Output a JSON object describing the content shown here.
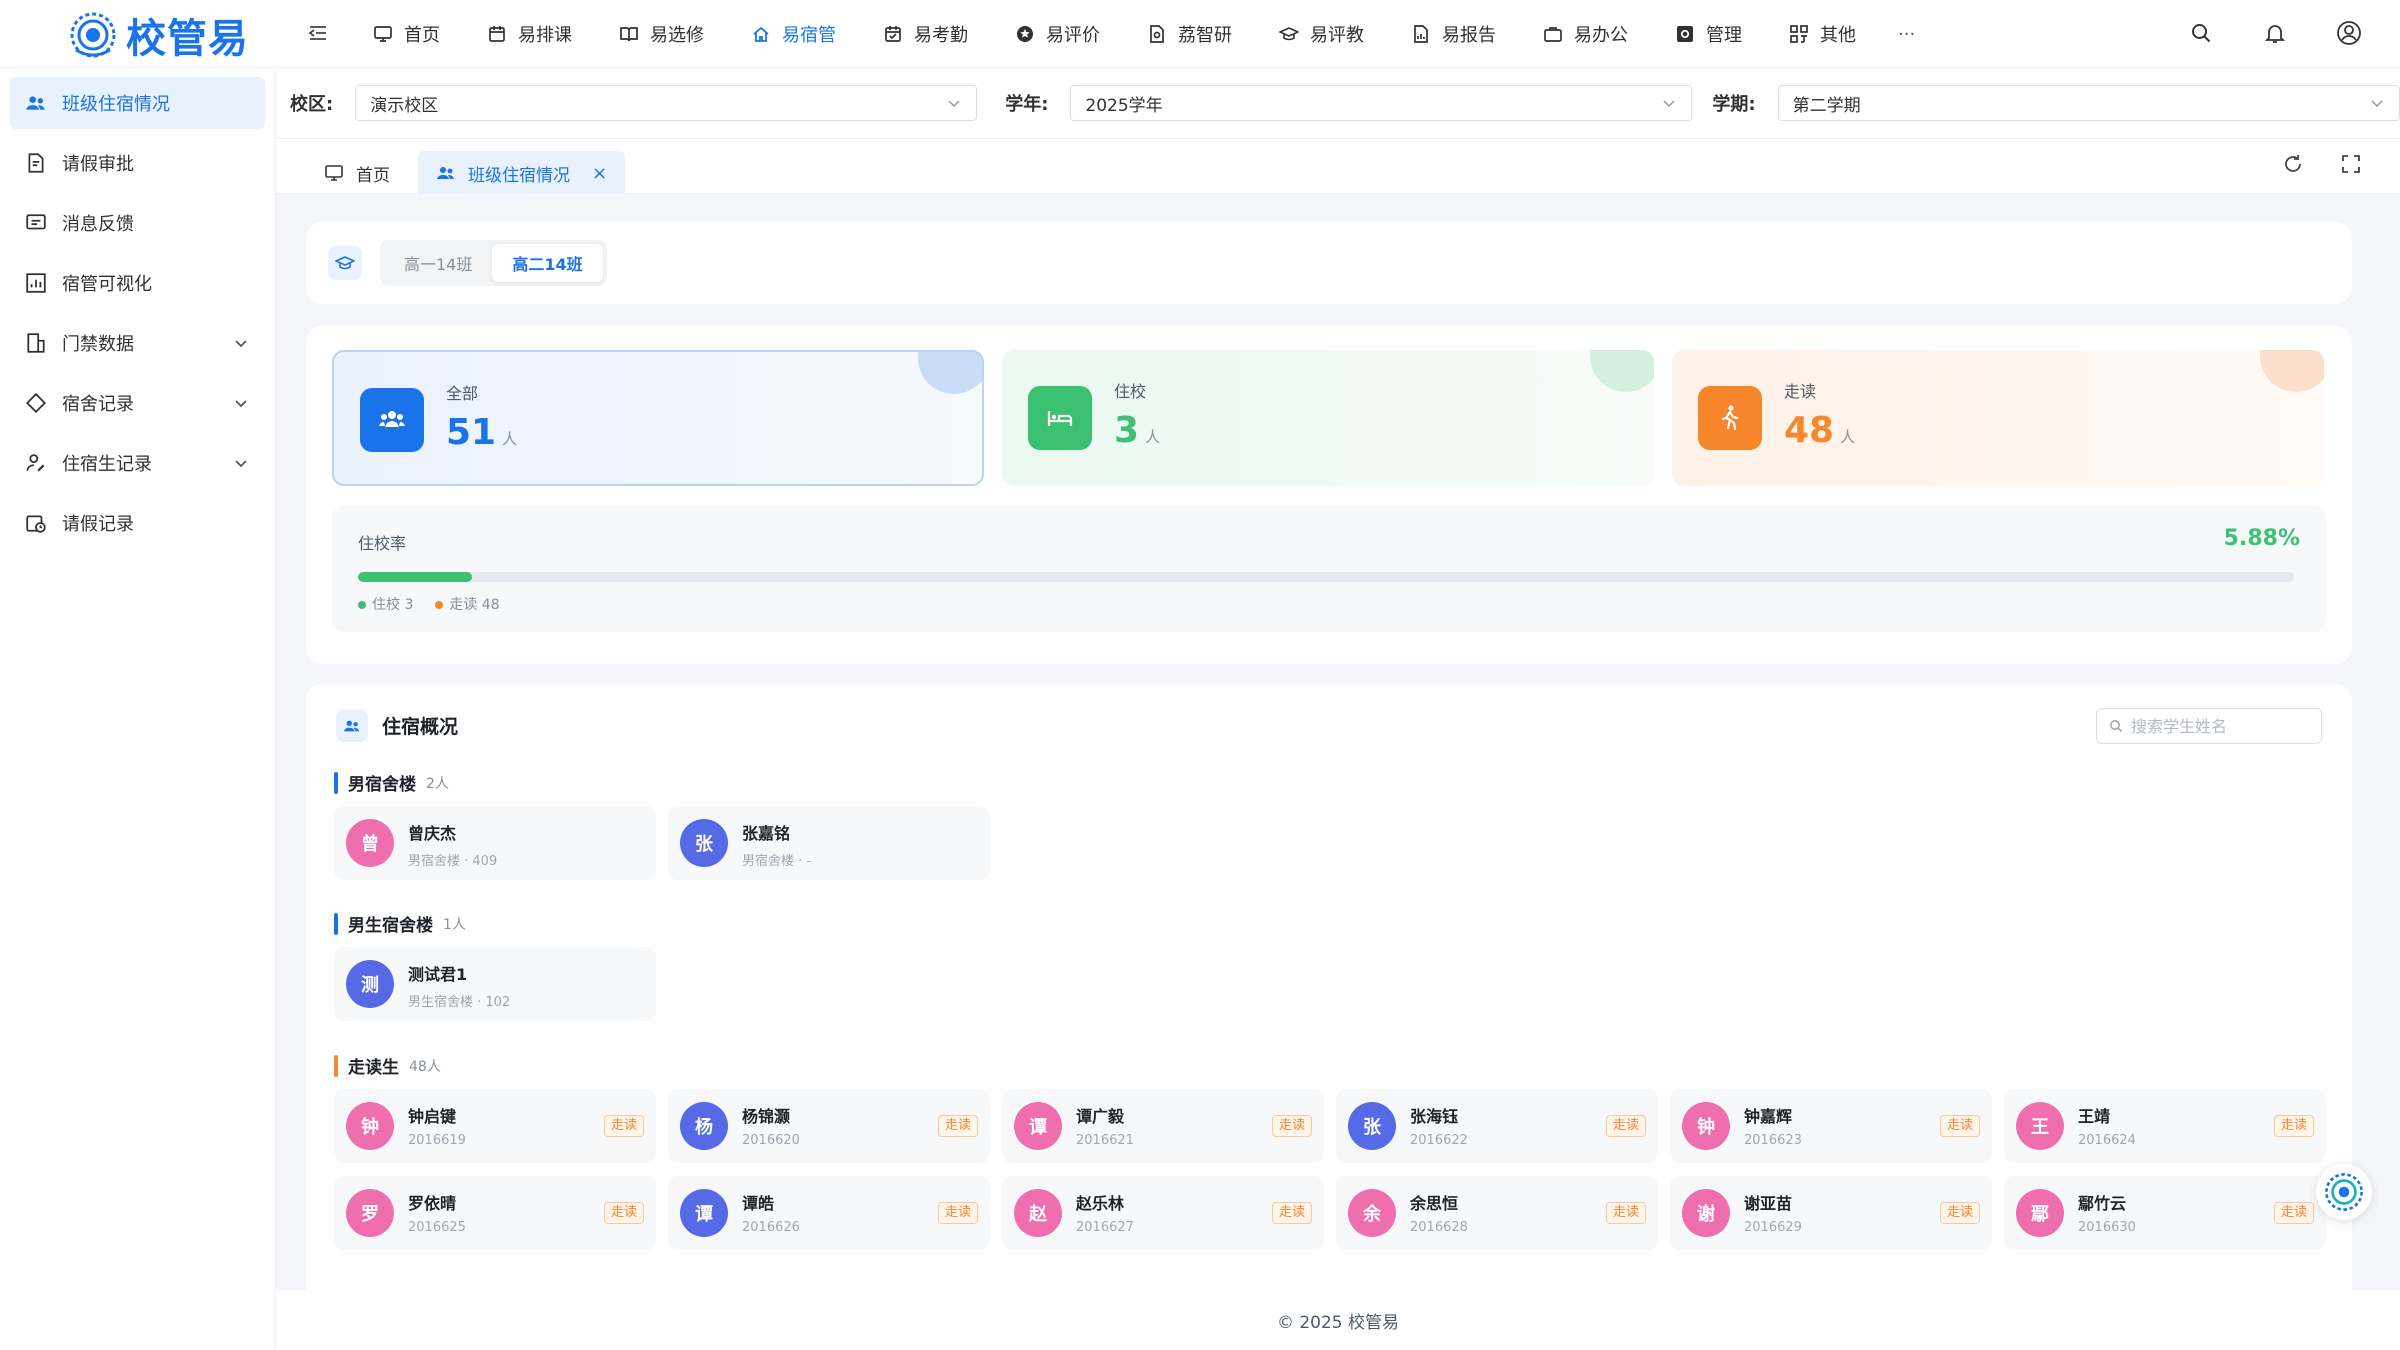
{
  "app": {
    "logo_text": "校管易"
  },
  "nav": [
    {
      "label": "首页",
      "icon": "monitor-icon"
    },
    {
      "label": "易排课",
      "icon": "calendar-icon"
    },
    {
      "label": "易选修",
      "icon": "book-icon"
    },
    {
      "label": "易宿管",
      "icon": "house-icon",
      "active": true
    },
    {
      "label": "易考勤",
      "icon": "calendar-check-icon"
    },
    {
      "label": "易评价",
      "icon": "star-icon"
    },
    {
      "label": "荔智研",
      "icon": "research-icon"
    },
    {
      "label": "易评教",
      "icon": "graduation-icon"
    },
    {
      "label": "易报告",
      "icon": "report-icon"
    },
    {
      "label": "易办公",
      "icon": "briefcase-icon"
    },
    {
      "label": "管理",
      "icon": "gear-icon"
    },
    {
      "label": "其他",
      "icon": "grid-icon"
    }
  ],
  "nav_more": "···",
  "sidebar": [
    {
      "label": "班级住宿情况",
      "icon": "users-icon",
      "active": true
    },
    {
      "label": "请假审批",
      "icon": "document-edit-icon"
    },
    {
      "label": "消息反馈",
      "icon": "message-icon"
    },
    {
      "label": "宿管可视化",
      "icon": "chart-icon"
    },
    {
      "label": "门禁数据",
      "icon": "gate-icon",
      "expandable": true
    },
    {
      "label": "宿舍记录",
      "icon": "diamond-icon",
      "expandable": true
    },
    {
      "label": "住宿生记录",
      "icon": "user-edit-icon",
      "expandable": true
    },
    {
      "label": "请假记录",
      "icon": "calendar-clock-icon"
    }
  ],
  "filters": {
    "campus_label": "校区:",
    "campus_value": "演示校区",
    "year_label": "学年:",
    "year_value": "2025学年",
    "term_label": "学期:",
    "term_value": "第二学期"
  },
  "tabs": [
    {
      "label": "首页"
    },
    {
      "label": "班级住宿情况",
      "active": true
    }
  ],
  "class_switch": [
    "高一14班",
    "高二14班"
  ],
  "stats": {
    "total_label": "全部",
    "total_value": "51",
    "unit": "人",
    "boarding_label": "住校",
    "boarding_value": "3",
    "walk_label": "走读",
    "walk_value": "48",
    "rate_label": "住校率",
    "rate_value": "5.88%",
    "rate_fraction": 0.0588,
    "legend_boarding": "住校 3",
    "legend_walk": "走读 48"
  },
  "colors": {
    "primary": "#1a73e8",
    "green": "#3cc071",
    "orange": "#f7862c",
    "pink": "#ef6fae",
    "indigo": "#5669e6"
  },
  "overview": {
    "title": "住宿概况",
    "search_placeholder": "搜索学生姓名",
    "groups": [
      {
        "name": "男宿舍楼",
        "count": "2人",
        "color": "#1a73e8",
        "students": [
          {
            "initial": "曾",
            "name": "曾庆杰",
            "sub": "男宿舍楼 · 409",
            "avatar": "pink"
          },
          {
            "initial": "张",
            "name": "张嘉铭",
            "sub": "男宿舍楼 · -",
            "avatar": "indigo"
          }
        ]
      },
      {
        "name": "男生宿舍楼",
        "count": "1人",
        "color": "#1a73e8",
        "students": [
          {
            "initial": "测",
            "name": "测试君1",
            "sub": "男生宿舍楼 · 102",
            "avatar": "indigo"
          }
        ]
      },
      {
        "name": "走读生",
        "count": "48人",
        "color": "#f7862c",
        "badge": "走读",
        "students": [
          {
            "initial": "钟",
            "name": "钟启键",
            "sub": "2016619",
            "avatar": "pink"
          },
          {
            "initial": "杨",
            "name": "杨锦灏",
            "sub": "2016620",
            "avatar": "indigo"
          },
          {
            "initial": "谭",
            "name": "谭广毅",
            "sub": "2016621",
            "avatar": "pink"
          },
          {
            "initial": "张",
            "name": "张海钰",
            "sub": "2016622",
            "avatar": "indigo"
          },
          {
            "initial": "钟",
            "name": "钟嘉辉",
            "sub": "2016623",
            "avatar": "pink"
          },
          {
            "initial": "王",
            "name": "王靖",
            "sub": "2016624",
            "avatar": "pink"
          },
          {
            "initial": "罗",
            "name": "罗依晴",
            "sub": "2016625",
            "avatar": "pink"
          },
          {
            "initial": "谭",
            "name": "谭皓",
            "sub": "2016626",
            "avatar": "indigo"
          },
          {
            "initial": "赵",
            "name": "赵乐林",
            "sub": "2016627",
            "avatar": "pink"
          },
          {
            "initial": "余",
            "name": "余思恒",
            "sub": "2016628",
            "avatar": "pink"
          },
          {
            "initial": "谢",
            "name": "谢亚苗",
            "sub": "2016629",
            "avatar": "pink"
          },
          {
            "initial": "鄢",
            "name": "鄢竹云",
            "sub": "2016630",
            "avatar": "pink"
          }
        ]
      }
    ]
  },
  "footer": "© 2025 校管易"
}
